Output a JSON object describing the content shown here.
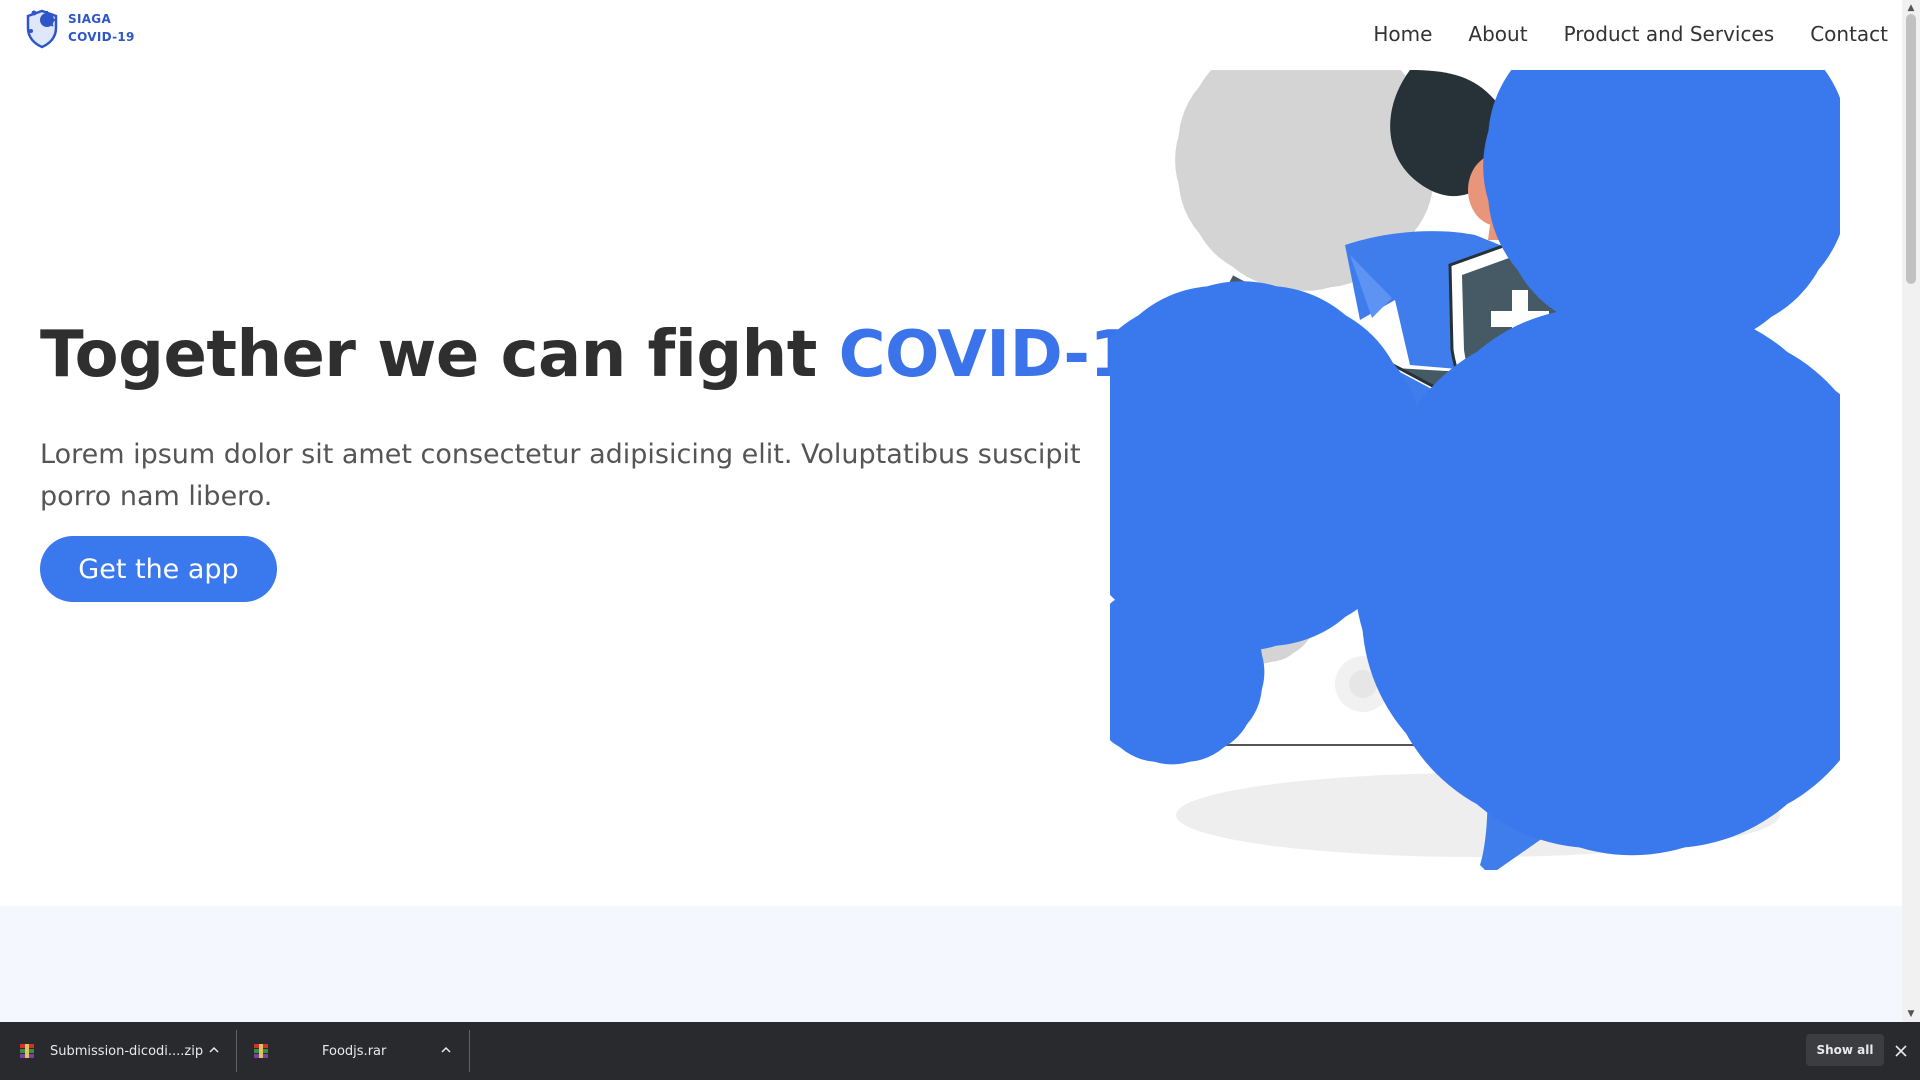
{
  "brand": {
    "line1": "SIAGA",
    "line2": "COVID-19"
  },
  "nav": {
    "home": "Home",
    "about": "About",
    "products": "Product and Services",
    "contact": "Contact"
  },
  "hero": {
    "title_prefix": "Together we can fight ",
    "title_highlight": "COVID-19",
    "subtitle": "Lorem ipsum dolor sit amet consectetur adipisicing elit. Voluptatibus suscipit porro nam libero.",
    "cta_label": "Get the app"
  },
  "downloads": [
    {
      "name": "Submission-dicodi....zip",
      "icon": "winrar-archive-icon"
    },
    {
      "name": "Foodjs.rar",
      "icon": "winrar-archive-icon"
    }
  ],
  "download_bar": {
    "show_all": "Show all"
  },
  "colors": {
    "accent": "#3b74ea",
    "brand": "#2f55c9",
    "section_bg": "#f4f7fd",
    "download_bar_bg": "#292a2d"
  },
  "icons": {
    "brand_logo": "virus-shield-icon",
    "chevron": "chevron-up-icon",
    "close": "close-icon"
  }
}
